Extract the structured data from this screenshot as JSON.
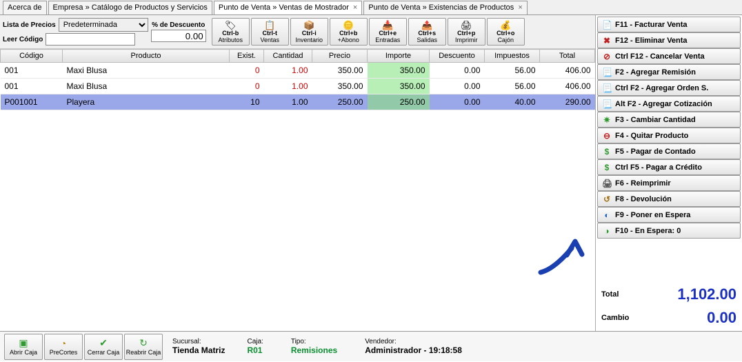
{
  "menu": {
    "acerca": "Acerca de"
  },
  "tabs": [
    {
      "label": "Empresa » Catálogo de Productos y Servicios",
      "active": false,
      "closable": false
    },
    {
      "label": "Punto de Venta » Ventas de Mostrador",
      "active": true,
      "closable": true
    },
    {
      "label": "Punto de Venta » Existencias de Productos",
      "active": false,
      "closable": true
    }
  ],
  "config": {
    "price_list_label": "Lista de Precios",
    "price_list_value": "Predeterminada",
    "read_code_label": "Leer Código",
    "discount_label": "% de Descuento",
    "discount_value": "0.00"
  },
  "toolbar": [
    {
      "icon": "🏷",
      "key": "Ctrl-b",
      "label": "Atributos"
    },
    {
      "icon": "📋",
      "key": "Ctrl-t",
      "label": "Ventas"
    },
    {
      "icon": "📦",
      "key": "Ctrl-i",
      "label": "Inventario"
    },
    {
      "icon": "🪙",
      "key": "Ctrl+b",
      "label": "+Abono"
    },
    {
      "icon": "📥",
      "key": "Ctrl+e",
      "label": "Entradas"
    },
    {
      "icon": "📤",
      "key": "Ctrl+s",
      "label": "Salidas"
    },
    {
      "icon": "🖨",
      "key": "Ctrl+p",
      "label": "Imprimir"
    },
    {
      "icon": "💰",
      "key": "Ctrl+o",
      "label": "Cajón"
    }
  ],
  "grid": {
    "headers": [
      "Código",
      "Producto",
      "Exist.",
      "Cantidad",
      "Precio",
      "Importe",
      "Descuento",
      "Impuestos",
      "Total"
    ],
    "rows": [
      {
        "codigo": "001",
        "producto": "Maxi Blusa",
        "exist": "0",
        "cantidad": "1.00",
        "precio": "350.00",
        "importe": "350.00",
        "descuento": "0.00",
        "impuestos": "56.00",
        "total": "406.00",
        "zero": true,
        "selected": false
      },
      {
        "codigo": "001",
        "producto": "Maxi Blusa",
        "exist": "0",
        "cantidad": "1.00",
        "precio": "350.00",
        "importe": "350.00",
        "descuento": "0.00",
        "impuestos": "56.00",
        "total": "406.00",
        "zero": true,
        "selected": false
      },
      {
        "codigo": "P001001",
        "producto": "Playera",
        "exist": "10",
        "cantidad": "1.00",
        "precio": "250.00",
        "importe": "250.00",
        "descuento": "0.00",
        "impuestos": "40.00",
        "total": "290.00",
        "zero": false,
        "selected": true
      }
    ]
  },
  "actions": [
    {
      "icon": "📄",
      "iconColor": "#e8a030",
      "label": "F11 - Facturar Venta"
    },
    {
      "icon": "✖",
      "iconColor": "#c02020",
      "label": "F12 - Eliminar Venta"
    },
    {
      "icon": "⊘",
      "iconColor": "#c02020",
      "label": "Ctrl F12 - Cancelar Venta"
    },
    {
      "icon": "📃",
      "iconColor": "#3a7ad0",
      "label": "F2 - Agregar Remisión"
    },
    {
      "icon": "📃",
      "iconColor": "#3a7ad0",
      "label": "Ctrl F2 - Agregar Orden S."
    },
    {
      "icon": "📃",
      "iconColor": "#3a7ad0",
      "label": "Alt F2 - Agregar Cotización"
    },
    {
      "icon": "✷",
      "iconColor": "#2f9a2f",
      "label": "F3 - Cambiar Cantidad"
    },
    {
      "icon": "⊖",
      "iconColor": "#c02020",
      "label": "F4 - Quitar Producto"
    },
    {
      "icon": "$",
      "iconColor": "#2f9a2f",
      "label": "F5 - Pagar de Contado"
    },
    {
      "icon": "$",
      "iconColor": "#2f9a2f",
      "label": "Ctrl F5 - Pagar a Crédito"
    },
    {
      "icon": "🖨",
      "iconColor": "#555",
      "label": "F6 - Reimprimir"
    },
    {
      "icon": "↺",
      "iconColor": "#a07010",
      "label": "F8 - Devolución"
    },
    {
      "icon": "◐",
      "iconColor": "#2060c0",
      "label": "F9 - Poner en Espera"
    },
    {
      "icon": "◑",
      "iconColor": "#2f9a2f",
      "label": "F10 - En Espera: 0"
    }
  ],
  "totals": {
    "total_label": "Total",
    "total_value": "1,102.00",
    "cambio_label": "Cambio",
    "cambio_value": "0.00"
  },
  "statusbar": {
    "buttons": [
      {
        "icon": "▣",
        "iconColor": "#2f9a2f",
        "label": "Abrir Caja"
      },
      {
        "icon": "◔",
        "iconColor": "#c08010",
        "label": "PreCortes"
      },
      {
        "icon": "✔",
        "iconColor": "#2f9a2f",
        "label": "Cerrar Caja"
      },
      {
        "icon": "↻",
        "iconColor": "#2f9a2f",
        "label": "Reabrir Caja"
      }
    ],
    "sucursal_label": "Sucursal:",
    "sucursal_value": "Tienda Matriz",
    "caja_label": "Caja:",
    "caja_value": "R01",
    "tipo_label": "Tipo:",
    "tipo_value": "Remisiones",
    "vendedor_label": "Vendedor:",
    "vendedor_value": "Administrador - 19:18:58"
  }
}
